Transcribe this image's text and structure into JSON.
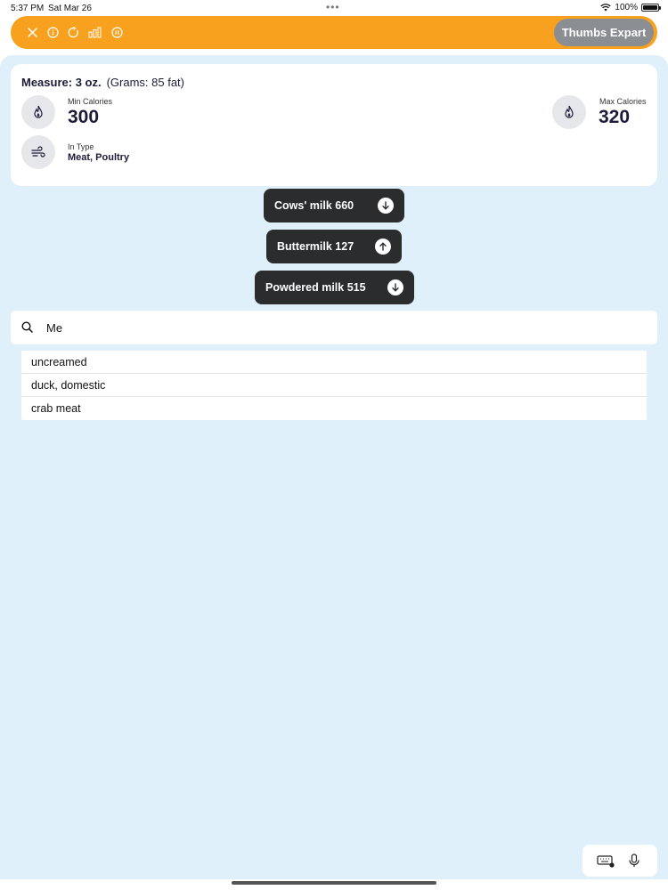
{
  "status": {
    "time": "5:37 PM",
    "date": "Sat Mar 26",
    "battery": "100%"
  },
  "toolbar": {
    "icons": [
      "close-icon",
      "info-icon",
      "refresh-icon",
      "bar-chart-icon",
      "pause-icon"
    ],
    "expert_label": "Thumbs Expart"
  },
  "card": {
    "measure_label": "Measure: 3 oz.",
    "grams_label": "(Grams: 85 fat)",
    "min_calories_label": "Min Calories",
    "min_calories_value": "300",
    "max_calories_label": "Max Calories",
    "max_calories_value": "320",
    "type_label": "In Type",
    "type_value": "Meat, Poultry"
  },
  "pills": [
    {
      "label": "Cows' milk 660",
      "arrow": "down"
    },
    {
      "label": "Buttermilk 127",
      "arrow": "up"
    },
    {
      "label": "Powdered milk 515",
      "arrow": "down"
    }
  ],
  "search": {
    "value": "Me"
  },
  "suggestions": [
    "uncreamed",
    "duck, domestic",
    "crab meat"
  ],
  "colors": {
    "toolbar": "#f7a11f",
    "background": "#dff0fa",
    "pill": "#2b2c2e",
    "expert_button": "#8a8e92"
  }
}
